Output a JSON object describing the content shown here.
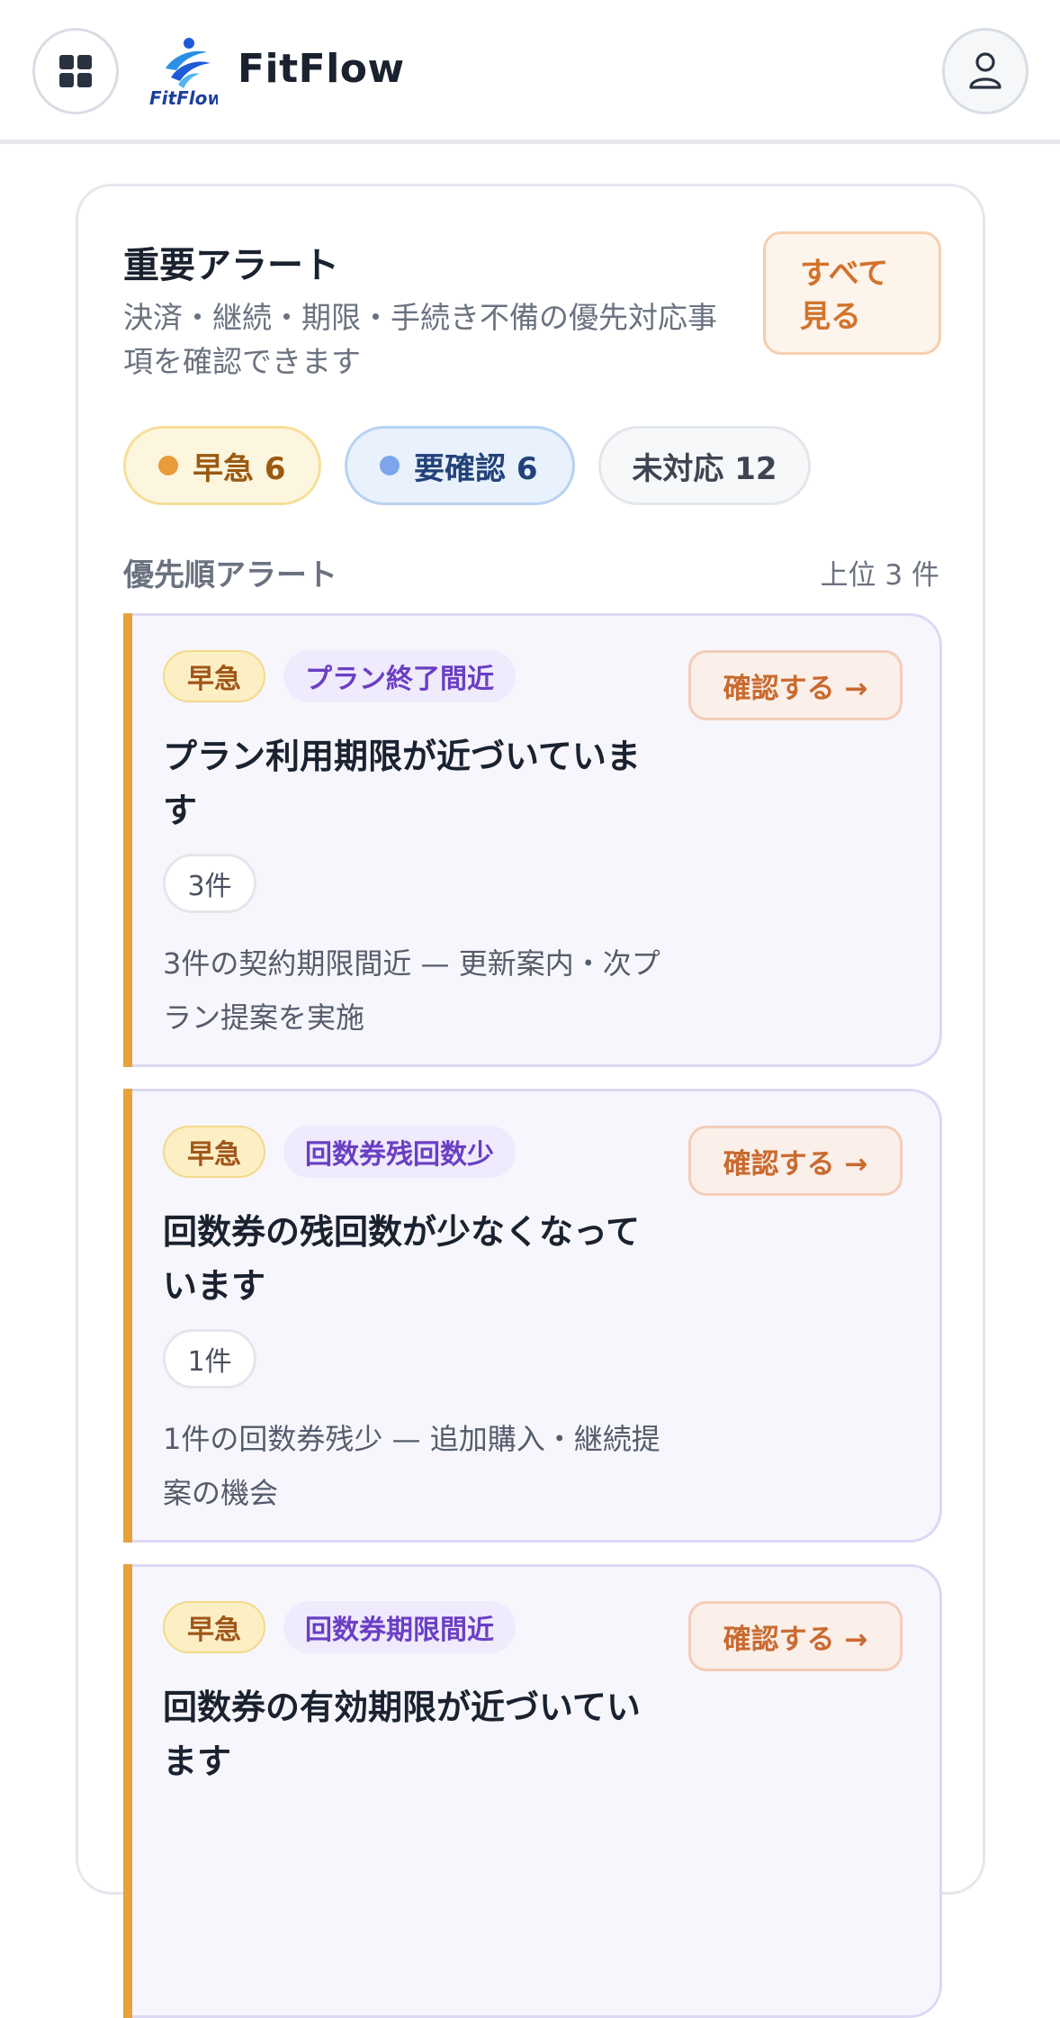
{
  "header": {
    "logo_text": "FitFlow",
    "brand": "FitFlow",
    "menu_icon": "grid-icon",
    "user_icon": "user-icon"
  },
  "alerts_card": {
    "title": "重要アラート",
    "description": "決済・継続・期限・手続き不備の優先対応事項を確認できます",
    "see_all_label": "すべて見る",
    "chips": {
      "urgent": "早急 6",
      "review": "要確認 6",
      "open": "未対応 12"
    },
    "section_title": "優先順アラート",
    "section_count": "上位 3 件",
    "items": [
      {
        "priority": "早急",
        "type": "プラン終了間近",
        "action": "確認する →",
        "title": "プラン利用期限が近づいています",
        "count": "3件",
        "description": "3件の契約期限間近 — 更新案内・次プラン提案を実施"
      },
      {
        "priority": "早急",
        "type": "回数券残回数少",
        "action": "確認する →",
        "title": "回数券の残回数が少なくなっています",
        "count": "1件",
        "description": "1件の回数券残少 — 追加購入・継続提案の機会"
      },
      {
        "priority": "早急",
        "type": "回数券期限間近",
        "action": "確認する →",
        "title": "回数券の有効期限が近づいています",
        "count": "",
        "description": ""
      }
    ]
  },
  "colors": {
    "accent_orange": "#e8a23c",
    "urgent_bg": "#fcefc4",
    "type_purple": "#6a3fc4",
    "review_blue": "#7da6ea"
  }
}
